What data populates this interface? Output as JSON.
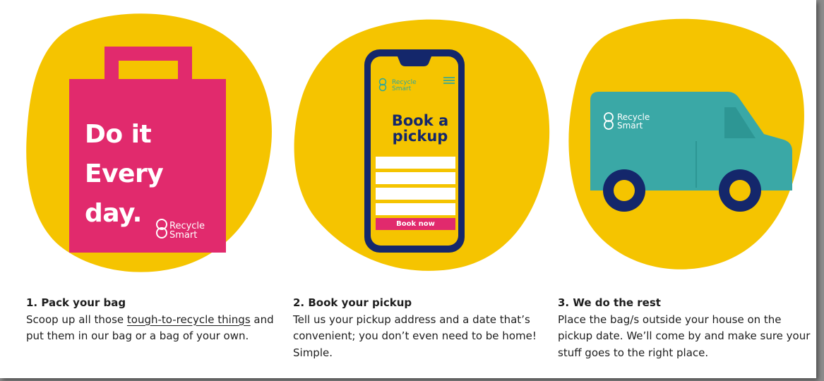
{
  "steps": [
    {
      "title": "1. Pack your bag",
      "text_before": "Scoop up all those ",
      "text_link": "tough-to-recycle things",
      "text_after": " and put them in our bag or a bag of your own."
    },
    {
      "title": "2. Book your pickup",
      "text": "Tell us your pickup address and a date that’s convenient; you don’t even need to be home! Simple."
    },
    {
      "title": "3. We do the rest",
      "text": "Place the bag/s outside your house on the pickup date. We’ll come by and make sure your stuff goes to the right place."
    }
  ],
  "bag": {
    "line1": "Do it",
    "line2": "Every",
    "line3": "day.",
    "logo_line1": "Recycle",
    "logo_line2": "Smart"
  },
  "phone": {
    "logo_line1": "Recycle",
    "logo_line2": "Smart",
    "headline_line1": "Book a",
    "headline_line2": "pickup",
    "button_label": "Book now"
  },
  "van": {
    "logo_line1": "Recycle",
    "logo_line2": "Smart"
  },
  "colors": {
    "blob": "#f5c400",
    "bag": "#e12a6d",
    "navy": "#14276b",
    "teal": "#3aa8a6",
    "text": "#1e1e1e"
  }
}
